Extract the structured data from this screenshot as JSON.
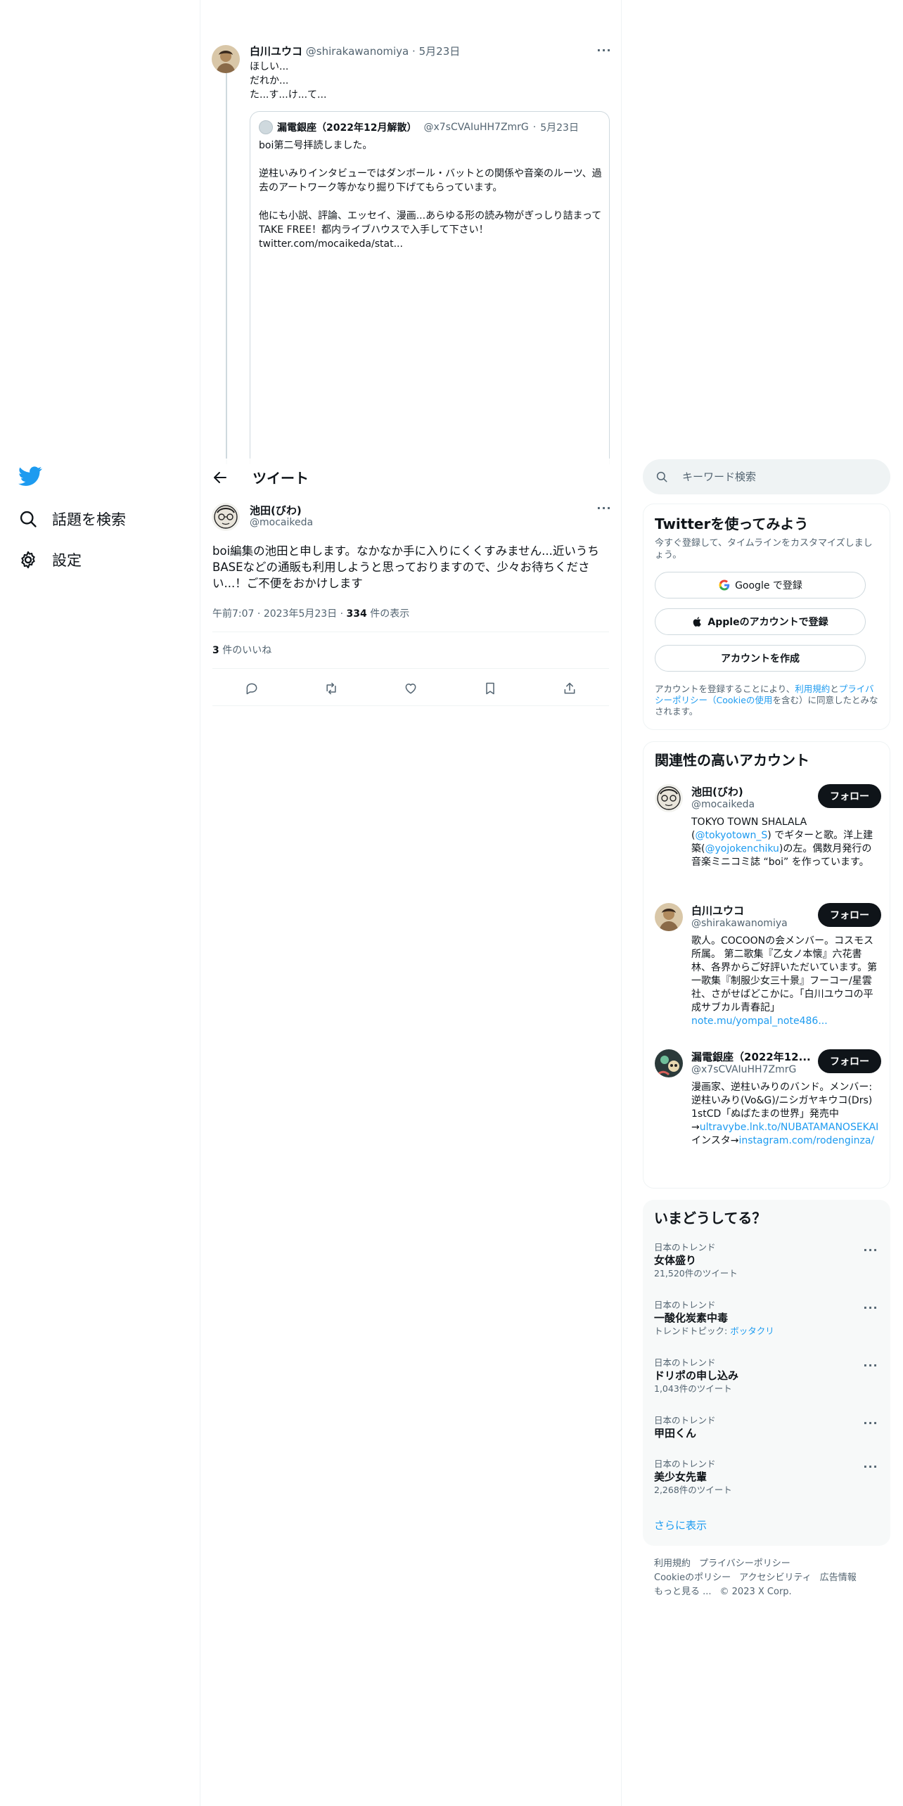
{
  "nav": {
    "explore_label": "話題を検索",
    "settings_label": "設定"
  },
  "context_tweet": {
    "author_name": "白川ユウコ",
    "author_handle": "@shirakawanomiya",
    "date": "5月23日",
    "body": "ほしい...\nだれか...\nた...す...け...て...",
    "quote": {
      "author_name": "漏電銀座（2022年12月解散）",
      "author_handle": "@x7sCVAIuHH7ZmrG",
      "date": "5月23日",
      "body": "boi第二号拝読しました。\n\n逆柱いみりインタビューではダンボール・バットとの関係や音楽のルーツ、過去のアートワーク等かなり掘り下げてもらっています。\n\n他にも小説、評論、エッセイ、漫画...あらゆる形の読み物がぎっしり詰まってTAKE FREE！都内ライブハウスで入手して下さい！\ntwitter.com/mocaikeda/stat..."
    }
  },
  "header": {
    "title": "ツイート"
  },
  "focus_tweet": {
    "author_name": "池田(びわ)",
    "author_handle": "@mocaikeda",
    "body": "boi編集の池田と申します。なかなか手に入りにくくすみません...近いうちBASEなどの通販も利用しようと思っておりますので、少々お待ちください...！ご不便をおかけします",
    "time": "午前7:07",
    "date": "2023年5月23日",
    "views_count": "334",
    "views_label": "件の表示",
    "likes_count": "3",
    "likes_label": "件のいいね"
  },
  "search": {
    "placeholder": "キーワード検索"
  },
  "signup": {
    "title": "Twitterを使ってみよう",
    "subtitle": "今すぐ登録して、タイムラインをカスタマイズしましょう。",
    "google_label": "Google で登録",
    "apple_label": "Appleのアカウントで登録",
    "create_label": "アカウントを作成",
    "terms_prefix": "アカウントを登録することにより、",
    "terms_link1": "利用規約",
    "terms_and": "と",
    "terms_link2": "プライバシーポリシー（Cookieの使用",
    "terms_suffix": "を含む）に同意したとみなされます。"
  },
  "related": {
    "title": "関連性の高いアカウント",
    "follow_label": "フォロー",
    "accounts": [
      {
        "name": "池田(びわ)",
        "handle": "@mocaikeda",
        "bio_1": "TOKYO TOWN SHALALA (",
        "bio_link1": "@tokyotown_S",
        "bio_2": ") でギターと歌。洋上建築(",
        "bio_link2": "@yojokenchiku",
        "bio_3": ")の左。偶数月発行の音楽ミニコミ誌 “boi” を作っています。"
      },
      {
        "name": "白川ユウコ",
        "handle": "@shirakawanomiya",
        "bio_1": "歌人。COCOONの会メンバー。コスモス所属。 第二歌集『乙女ノ本懐』六花書林、各界からご好評いただいています。第一歌集『制服少女三十景』フーコー/星雲社、さがせばどこかに。「白川ユウコの平成サブカル青春記」",
        "bio_link1": "note.mu/yompal_note486..."
      },
      {
        "name": "漏電銀座（2022年12...",
        "handle": "@x7sCVAIuHH7ZmrG",
        "bio_1": "漫画家、逆柱いみりのバンド。メンバー:逆柱いみり(Vo&G)/ニシガヤキウコ(Drs) 1stCD「ぬばたまの世界」発売中→",
        "bio_link1": "ultravybe.lnk.to/NUBATAMANOSEKAI",
        "bio_2": " インスタ→",
        "bio_link2": "instagram.com/rodenginza/"
      }
    ]
  },
  "trends": {
    "title": "いまどうしてる？",
    "items": [
      {
        "category": "日本のトレンド",
        "name": "女体盛り",
        "sub": "21,520件のツイート"
      },
      {
        "category": "日本のトレンド",
        "name": "一酸化炭素中毒",
        "sub_prefix": "トレンドトピック: ",
        "sub_link": "ボッタクリ"
      },
      {
        "category": "日本のトレンド",
        "name": "ドリポの申し込み",
        "sub": "1,043件のツイート"
      },
      {
        "category": "日本のトレンド",
        "name": "甲田くん"
      },
      {
        "category": "日本のトレンド",
        "name": "美少女先輩",
        "sub": "2,268件のツイート"
      }
    ],
    "show_more": "さらに表示"
  },
  "footer": {
    "terms": "利用規約",
    "privacy": "プライバシーポリシー",
    "cookie": "Cookieのポリシー",
    "accessibility": "アクセシビリティ",
    "ads": "広告情報",
    "more": "もっと見る ...",
    "copyright": "© 2023 X Corp."
  },
  "colors": {
    "brand": "#1d9bf0",
    "text": "#0f1419",
    "secondary": "#536471",
    "border": "#eff3f4"
  }
}
